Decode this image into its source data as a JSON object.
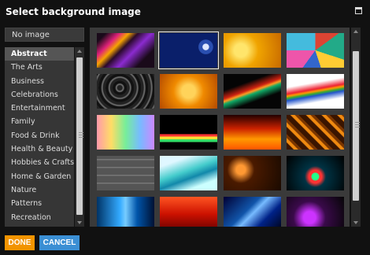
{
  "dialog": {
    "title": "Select background image"
  },
  "no_image_label": "No image",
  "categories": [
    {
      "label": "Abstract",
      "selected": true
    },
    {
      "label": "The Arts"
    },
    {
      "label": "Business"
    },
    {
      "label": "Celebrations"
    },
    {
      "label": "Entertainment"
    },
    {
      "label": "Family"
    },
    {
      "label": "Food & Drink"
    },
    {
      "label": "Health & Beauty"
    },
    {
      "label": "Hobbies & Crafts"
    },
    {
      "label": "Home & Garden"
    },
    {
      "label": "Nature"
    },
    {
      "label": "Patterns"
    },
    {
      "label": "Recreation"
    }
  ],
  "thumbnails": [
    {
      "name": "rainbow-arc-stripes",
      "bg": "linear-gradient(135deg,#1a0a1a 10%,#e0227a 25%,#f5a300 35%,#2a0a2a 45%,#8b2bd0 60%,#1a0a1a 80%)"
    },
    {
      "name": "blue-circles",
      "bg": "radial-gradient(circle at 80% 40%,#dfe8ff 0 6%,#2a4fb0 7% 14%,#0a1f6a 15% 100%)",
      "selected": true
    },
    {
      "name": "golden-sparkle",
      "bg": "radial-gradient(circle at 30% 50%,#ffe56b 0 15%,#f0a400 40%,#c86a00 100%)"
    },
    {
      "name": "colorful-graffiti",
      "bg": "conic-gradient(#d43 0 15%,#2a8 15% 30%,#fc3 30% 45%,#36c 45% 60%,#e5a 60% 75%,#4bd 75% 100%)"
    },
    {
      "name": "dark-swirls",
      "bg": "repeating-radial-gradient(circle at 40% 40%,#222 0 3px,#666 4px 5px,#111 6px 9px)"
    },
    {
      "name": "orange-swirls",
      "bg": "radial-gradient(circle at 50% 50%,#ffd35a 0 20%,#f08a00 45%,#b44a00 100%)"
    },
    {
      "name": "light-trails",
      "bg": "linear-gradient(160deg,#050505 30%,#c21 45%,#f92 50%,#1a6 55%,#050505 70%)"
    },
    {
      "name": "rainbow-waves",
      "bg": "linear-gradient(170deg,#fff 30%,#e23 45%,#f90 50%,#3a3 55%,#25c 60%,#fff 75%)"
    },
    {
      "name": "pastel-bokeh",
      "bg": "linear-gradient(90deg,#f9a 0%,#fd6 25%,#7e9 50%,#7bf 75%,#c8f 100%)"
    },
    {
      "name": "equalizer-bars",
      "bg": "linear-gradient(180deg,#000 0 55%,#f33 56% 62%,#fd3 63% 70%,#3d6 71% 78%,#000 79% 100%)"
    },
    {
      "name": "fire-flames",
      "bg": "linear-gradient(0deg,#f50 0%,#f90 30%,#c20 60%,#200 100%)"
    },
    {
      "name": "orange-squares",
      "bg": "repeating-linear-gradient(45deg,#3a1500 0 6px,#f08a10 7px 10px,#7a3500 11px 14px)"
    },
    {
      "name": "grey-cubes",
      "bg": "repeating-linear-gradient(0deg,#555 0 8px,#777 9px 10px),#666"
    },
    {
      "name": "aqua-waves",
      "bg": "linear-gradient(160deg,#dff7ff 20%,#4cc 45%,#18a 60%,#cff 80%)"
    },
    {
      "name": "orange-dots",
      "bg": "radial-gradient(circle at 30% 40%,#f93 0 10%,#4a1a00 30%,#1a0a00 100%)"
    },
    {
      "name": "green-bokeh",
      "bg": "radial-gradient(circle at 50% 60%,#2f8 0 10%,#f33 12% 18%,#034 30%,#000 100%)"
    },
    {
      "name": "blue-streaks",
      "bg": "linear-gradient(90deg,#036 0%,#3af 40%,#7cf 50%,#05a 70%,#013 100%)"
    },
    {
      "name": "red-shapes",
      "bg": "linear-gradient(180deg,#f52 0%,#c10 50%,#600 100%)"
    },
    {
      "name": "blue-rays",
      "bg": "linear-gradient(135deg,#003 0%,#15a 40%,#7bf 50%,#028 70%,#001 100%)"
    },
    {
      "name": "purple-glow",
      "bg": "radial-gradient(circle at 40% 60%,#c3f 0 15%,#3a0a4a 40%,#050505 100%)"
    }
  ],
  "buttons": {
    "done": "DONE",
    "cancel": "CANCEL"
  }
}
